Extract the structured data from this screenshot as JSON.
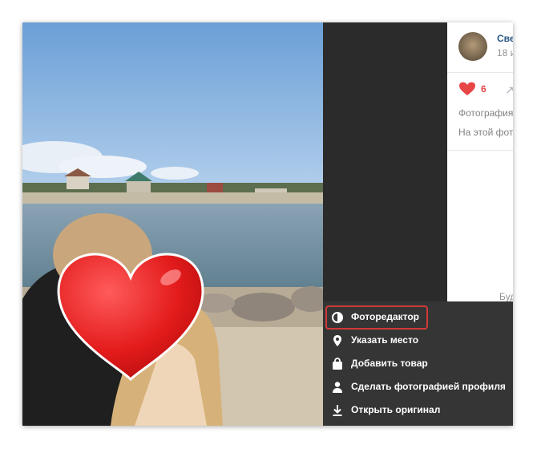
{
  "post": {
    "author": "Све",
    "date": "18 и",
    "likes": "6",
    "description_line1": "Фотография",
    "description_line2": "На этой фот",
    "comment_hint": "Буд"
  },
  "menu": {
    "items": [
      {
        "label": "Фоторедактор",
        "icon": "photo-editor-icon"
      },
      {
        "label": "Указать место",
        "icon": "location-pin-icon"
      },
      {
        "label": "Добавить товар",
        "icon": "shopping-bag-icon"
      },
      {
        "label": "Сделать фотографией профиля",
        "icon": "person-icon"
      },
      {
        "label": "Открыть оригинал",
        "icon": "download-icon"
      }
    ],
    "highlighted_item": "Фоторедактор"
  },
  "colors": {
    "menu_bg": "#353535",
    "highlight": "#d23a3a",
    "like": "#e64646",
    "link": "#2a5885"
  }
}
